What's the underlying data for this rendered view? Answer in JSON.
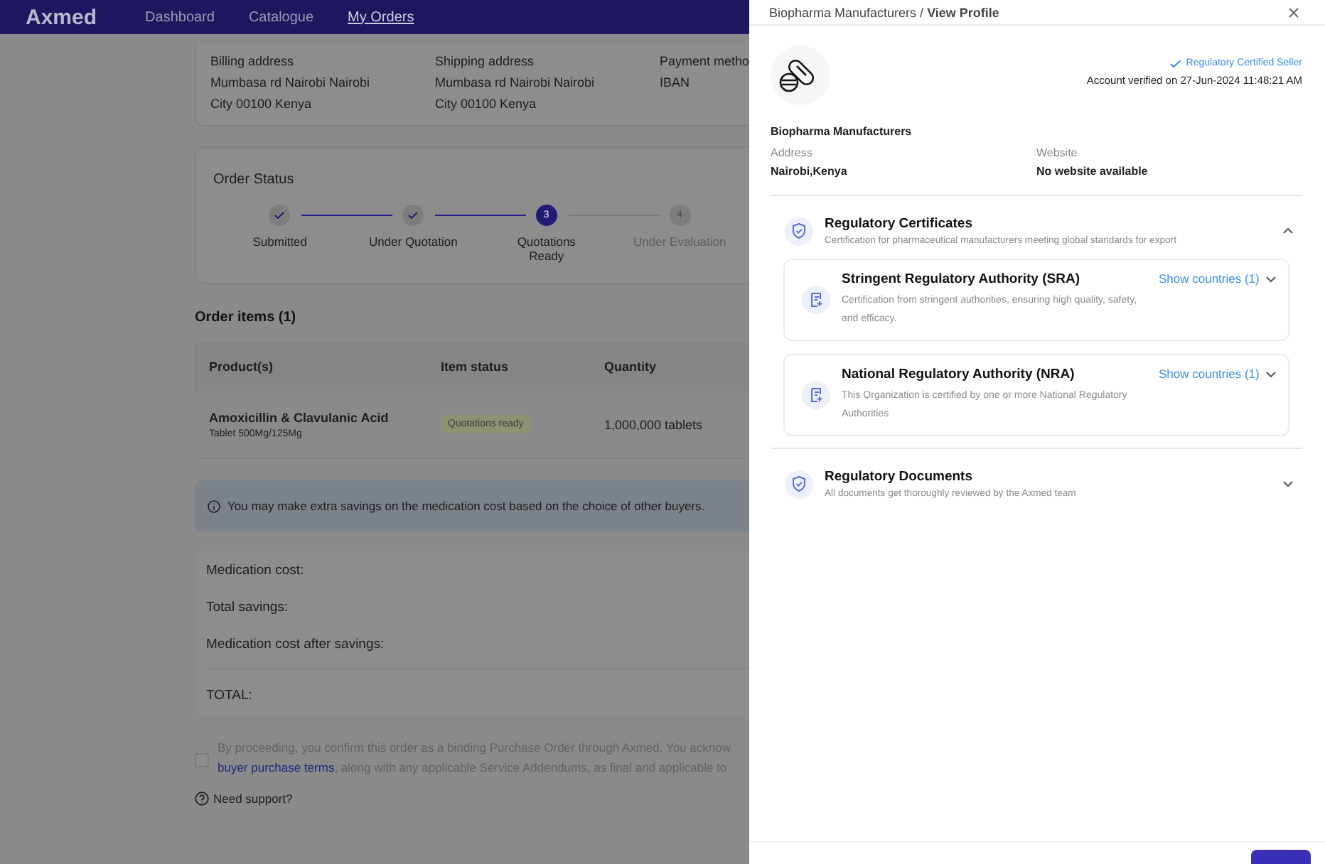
{
  "nav": {
    "brand": "Axmed",
    "links": [
      {
        "label": "Dashboard",
        "selected": false
      },
      {
        "label": "Catalogue",
        "selected": false
      },
      {
        "label": "My Orders",
        "selected": true
      }
    ]
  },
  "addresses": [
    {
      "label": "Billing address",
      "lines": [
        "Mumbasa rd Nairobi Nairobi",
        "City 00100 Kenya"
      ]
    },
    {
      "label": "Shipping address",
      "lines": [
        "Mumbasa rd Nairobi Nairobi",
        "City 00100 Kenya"
      ]
    },
    {
      "label": "Payment metho",
      "lines": [
        "IBAN"
      ]
    }
  ],
  "order_status": {
    "title": "Order Status",
    "steps": [
      {
        "label": "Submitted",
        "done": true,
        "current": false
      },
      {
        "label": "Under Quotation",
        "done": true,
        "current": false
      },
      {
        "label": "Quotations Ready",
        "done": false,
        "current": true,
        "number": "3"
      },
      {
        "label": "Under Evaluation",
        "done": false,
        "current": false,
        "number": "4"
      }
    ]
  },
  "order_items": {
    "title": "Order items (1)",
    "columns": [
      "Product(s)",
      "Item status",
      "Quantity"
    ],
    "rows": [
      {
        "product": "Amoxicillin & Clavulanic Acid",
        "detail": "Tablet 500Mg/125Mg",
        "status": "Quotations ready",
        "quantity": "1,000,000 tablets"
      }
    ]
  },
  "info": "You may make extra savings on the medication cost based on the choice of other buyers.",
  "summary": {
    "rows": [
      "Medication cost:",
      "Total savings:",
      "Medication cost after savings:"
    ],
    "total": "TOTAL:"
  },
  "consent": {
    "checked": false,
    "line1": "By proceeding, you confirm this order as a binding Purchase Order through Axmed. You acknow",
    "link": "buyer purchase terms",
    "line2": ", along with any applicable Service Addendums, as final and applicable to"
  },
  "support": "Need support?",
  "drawer": {
    "breadcrumb": "Biopharma Manufacturers / **View Profile**",
    "certified": "Regulatory Certified Seller",
    "verified": "Account verified on 27-Jun-2024 11:48:21 AM",
    "name": "Biopharma Manufacturers",
    "fields": [
      {
        "label": "Address",
        "value": "Nairobi,Kenya"
      },
      {
        "label": "Website",
        "value": "No website available"
      }
    ],
    "sections": [
      {
        "title": "Regulatory Certificates",
        "subtitle": "Certification for pharmaceutical manufacturers meeting global standards for export",
        "expanded": true,
        "certificates": [
          {
            "title": "Stringent Regulatory Authority (SRA)",
            "description": "Certification from stringent authorities, ensuring high quality, safety, and efficacy.",
            "action": "Show countries (1)"
          },
          {
            "title": "National Regulatory Authority (NRA)",
            "description": "This Organization is certified by one or more National Regulatory Authorities",
            "action": "Show countries (1)"
          }
        ]
      },
      {
        "title": "Regulatory Documents",
        "subtitle": "All documents get thoroughly reviewed by the Axmed team",
        "expanded": false
      }
    ]
  }
}
